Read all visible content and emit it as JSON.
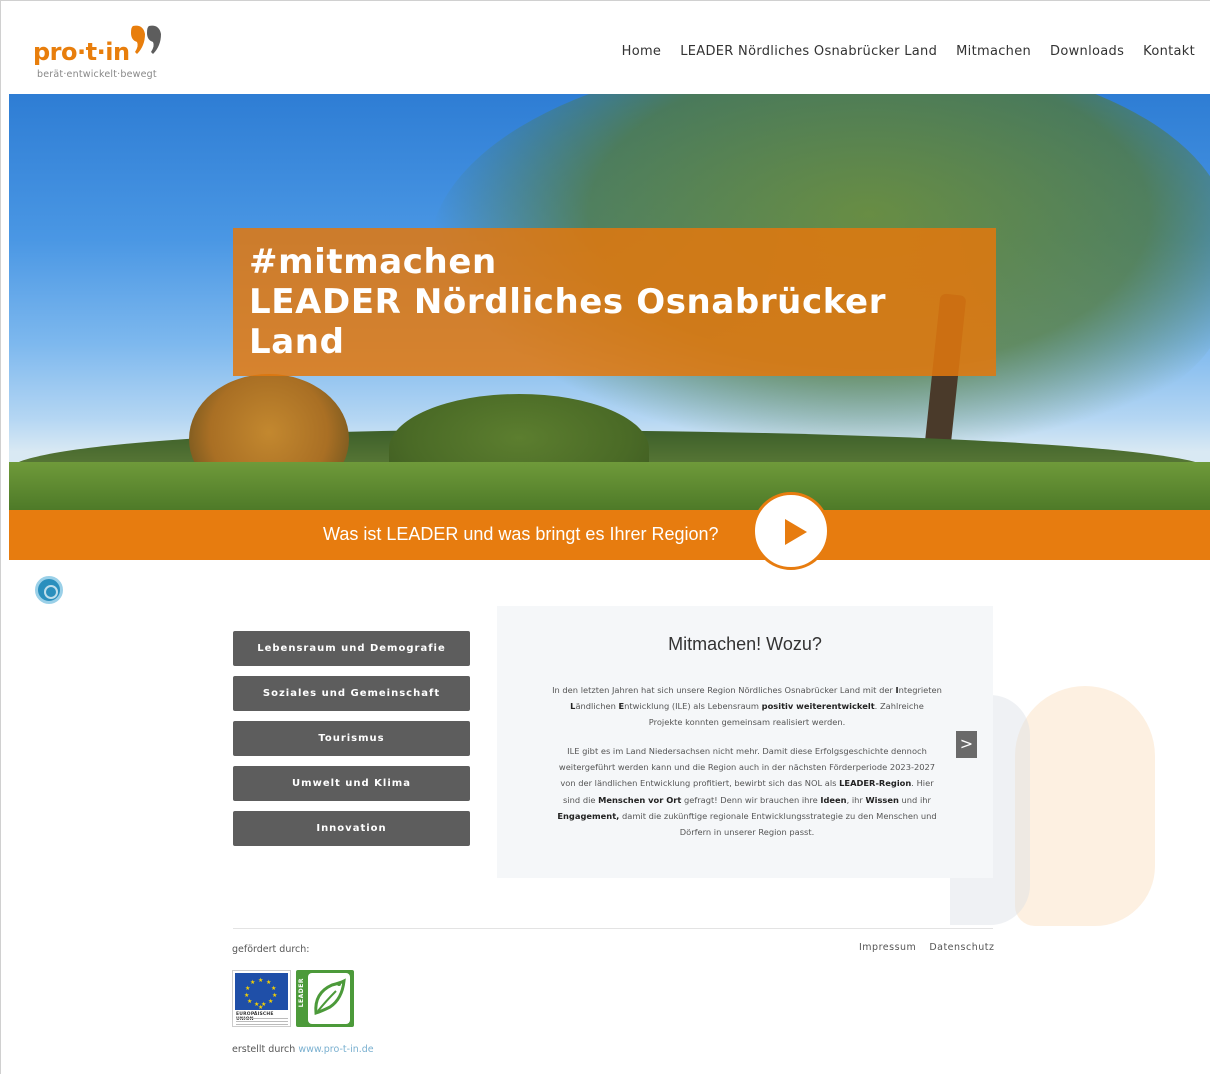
{
  "header": {
    "logo_text": "pro·t·in",
    "logo_tagline": "berät·entwickelt·bewegt",
    "nav": [
      "Home",
      "LEADER Nördliches Osnabrücker Land",
      "Mitmachen",
      "Downloads",
      "Kontakt"
    ]
  },
  "hero": {
    "headline_line1": "#mitmachen",
    "headline_line2": "LEADER Nördliches Osnabrücker",
    "headline_line3": "Land"
  },
  "video_bar": {
    "text": "Was ist LEADER und was bringt es Ihrer Region?"
  },
  "categories": [
    "Lebensraum und Demografie",
    "Soziales und Gemeinschaft",
    "Tourismus",
    "Umwelt und Klima",
    "Innovation"
  ],
  "panel": {
    "title": "Mitmachen! Wozu?",
    "p1_a": "In den letzten Jahren hat sich unsere Region Nördliches Osnabrücker Land mit der ",
    "p1_i": "I",
    "p1_b": "ntegrieten ",
    "p1_l": "L",
    "p1_c": "ändlichen ",
    "p1_e": "E",
    "p1_d": "ntwicklung (ILE) als Lebensraum ",
    "p1_bold": "positiv weiterentwickelt",
    "p1_end": ". Zahlreiche Projekte konnten gemeinsam realisiert werden.",
    "p2_a": "ILE gibt es im Land Niedersachsen nicht mehr. Damit diese Erfolgsgeschichte dennoch weitergeführt werden kann und die Region auch in der nächsten Förderperiode 2023-2027 von der ländlichen Entwicklung profitiert, bewirbt sich das NOL als ",
    "p2_leader": "LEADER-Region",
    "p2_b": ". Hier sind die ",
    "p2_menschen": "Menschen vor Ort",
    "p2_c": " gefragt! Denn wir brauchen ihre ",
    "p2_ideen": "Ideen",
    "p2_d": ", ihr ",
    "p2_wissen": "Wissen",
    "p2_e": " und ihr ",
    "p2_engagement": "Engagement,",
    "p2_f": " damit die zukünftige regionale Entwicklungsstrategie zu den Menschen und Dörfern in unserer Region passt.",
    "next_label": ">"
  },
  "footer": {
    "funded_label": "gefördert durch:",
    "links": [
      "Impressum",
      "Datenschutz"
    ],
    "eu_label": "EUROPÄISCHE UNION",
    "leader_label": "LEADER",
    "created_label": "erstellt durch ",
    "created_link": "www.pro-t-in.de"
  },
  "colors": {
    "accent_orange": "#e77c0f",
    "button_gray": "#5d5d5d",
    "eu_blue": "#1f4fa8",
    "leader_green": "#4c9a3a"
  }
}
